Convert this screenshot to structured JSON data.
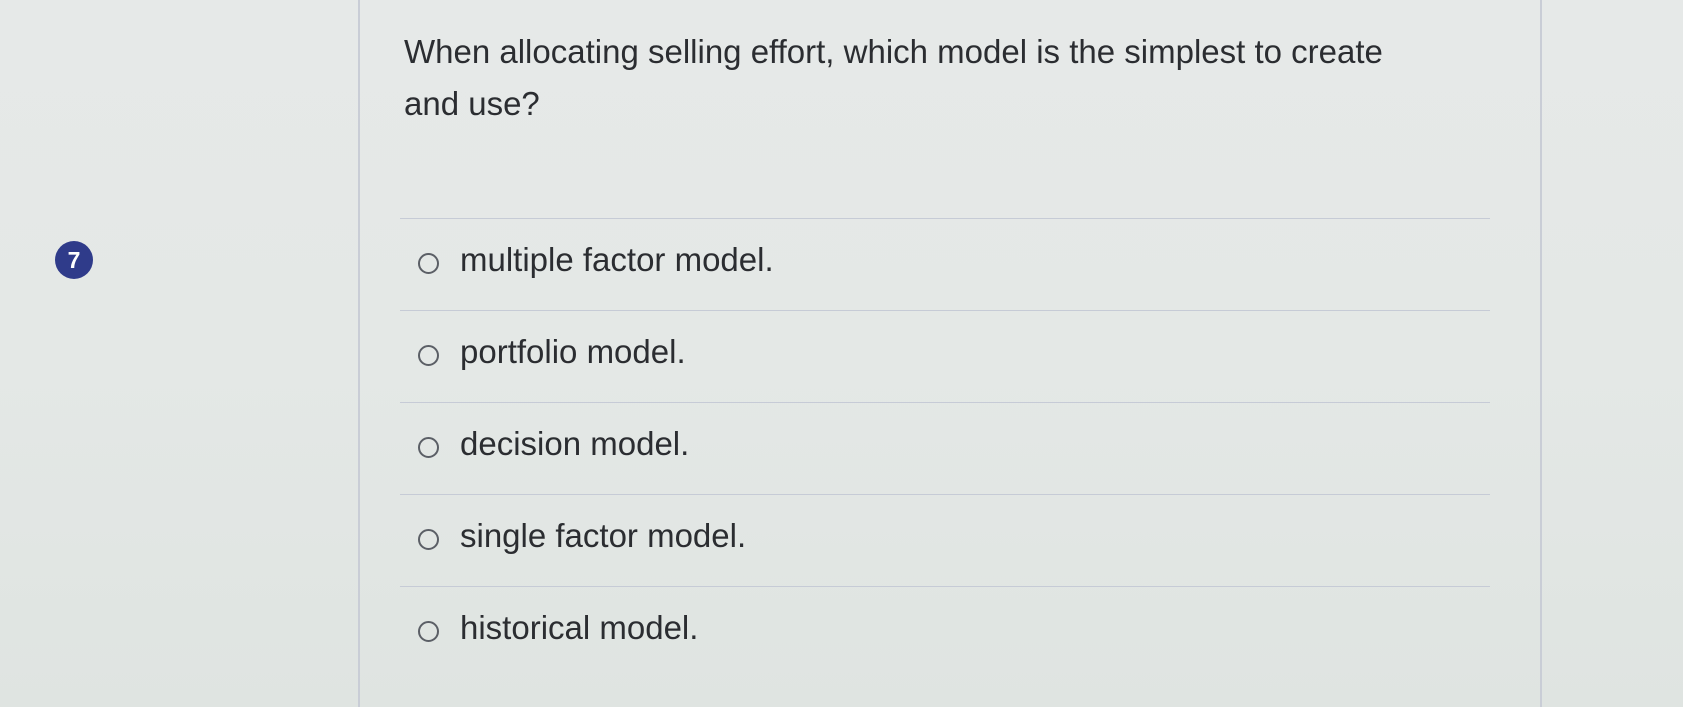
{
  "question": {
    "number": "7",
    "text": "When allocating selling effort, which model is the simplest to create and use?"
  },
  "options": [
    {
      "label": "multiple factor model."
    },
    {
      "label": "portfolio model."
    },
    {
      "label": "decision model."
    },
    {
      "label": "single factor model."
    },
    {
      "label": "historical model."
    }
  ],
  "colors": {
    "badge": "#2f3b8a",
    "text": "#2b2d31",
    "rule": "#c6cbd6"
  }
}
